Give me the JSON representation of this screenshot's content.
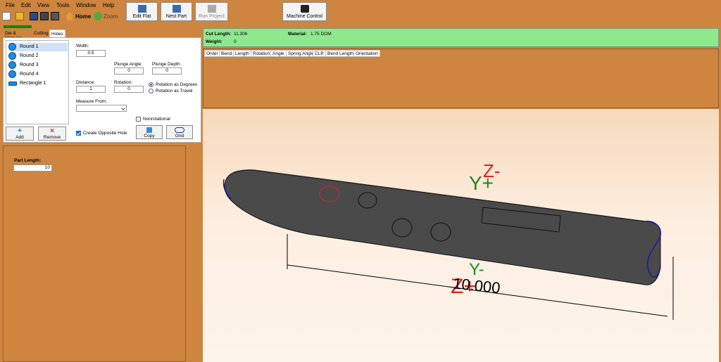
{
  "menu": [
    "File",
    "Edit",
    "View",
    "Tools",
    "Window",
    "Help"
  ],
  "toolbar": {
    "home_label": "Home",
    "zoom_label": "Zoom",
    "edit_flat": "Edit Flat",
    "nest_part": "Nest Part",
    "run_project": "Run Project",
    "machine_control": "Machine Control"
  },
  "tabs": [
    "Die & Material",
    "Cutting",
    "Holes"
  ],
  "holes": {
    "items": [
      "Round 1",
      "Round 2",
      "Round 3",
      "Round 4",
      "Rectangle 1"
    ],
    "add_label": "Add",
    "remove_label": "Remove",
    "width_label": "Width:",
    "width_value": "0.5",
    "plunge_angle_label": "Plunge Angle:",
    "plunge_angle_value": "0",
    "plunge_depth_label": "Plunge Depth:",
    "plunge_depth_value": "0",
    "distance_label": "Distance:",
    "distance_value": "1",
    "rotation_label": "Rotation:",
    "rotation_value": "0",
    "rotation_degrees": "Rotation as Degrees",
    "rotation_travel": "Rotation as Travel",
    "measure_from_label": "Measure From:",
    "measure_from_value": "",
    "nonrotational_label": "Nonrotational",
    "create_opposite_label": "Create Opposite Hole",
    "copy_label": "Copy",
    "grid_label": "Grid"
  },
  "part": {
    "length_label": "Part Length:",
    "length_value": "10"
  },
  "info": {
    "cut_length_label": "Cut Length:",
    "cut_length_value": "11.306",
    "material_label": "Material:",
    "material_value": "1.75 DOM",
    "weight_label": "Weight:",
    "weight_value": "0"
  },
  "columns": [
    "Order",
    "Bend",
    "Length",
    "Rotation",
    "Angle",
    "Spring Angle",
    "CLR",
    "Bend Length",
    "Orientation"
  ],
  "viewport": {
    "axis_z_minus": "Z-",
    "axis_y_plus": "Y+",
    "axis_y_minus": "Y-",
    "axis_z_plus": "Z+",
    "dimension": "10.000"
  },
  "colors": {
    "background": "#cd853f",
    "info_bar": "#8ee88e",
    "tube": "#4a4a4a",
    "axis_red": "#e02020",
    "axis_green": "#1a8a1a"
  }
}
